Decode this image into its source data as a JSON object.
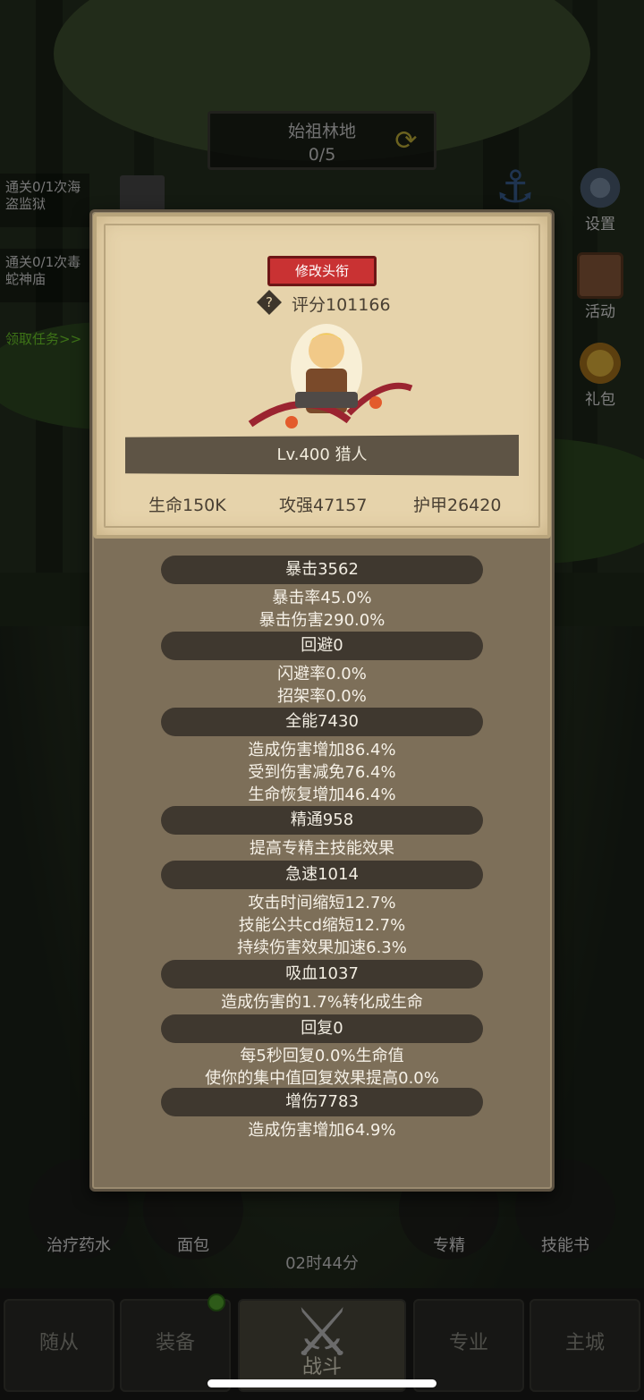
{
  "stage": {
    "name": "始祖林地",
    "progress": "0/5"
  },
  "quests": [
    {
      "text": "通关0/1次海盗监狱"
    },
    {
      "text": "通关0/1次毒蛇神庙"
    }
  ],
  "quest_link": "领取任务>>",
  "side_buttons": {
    "settings": "设置",
    "activity": "活动",
    "gift": "礼包"
  },
  "panel": {
    "rename_button": "修改头衔",
    "score": "评分101166",
    "character": "Lv.400 猎人",
    "card_stats": [
      "生命150K",
      "攻强47157",
      "护甲26420"
    ],
    "stats": [
      {
        "title": "暴击3562",
        "lines": [
          "暴击率45.0%",
          "暴击伤害290.0%"
        ]
      },
      {
        "title": "回避0",
        "lines": [
          "闪避率0.0%",
          "招架率0.0%"
        ]
      },
      {
        "title": "全能7430",
        "lines": [
          "造成伤害增加86.4%",
          "受到伤害减免76.4%",
          "生命恢复增加46.4%"
        ]
      },
      {
        "title": "精通958",
        "lines": [
          "提高专精主技能效果"
        ]
      },
      {
        "title": "急速1014",
        "lines": [
          "攻击时间缩短12.7%",
          "技能公共cd缩短12.7%",
          "持续伤害效果加速6.3%"
        ]
      },
      {
        "title": "吸血1037",
        "lines": [
          "造成伤害的1.7%转化成生命"
        ]
      },
      {
        "title": "回复0",
        "lines": [
          "每5秒回复0.0%生命值",
          "使你的集中值回复效果提高0.0%"
        ]
      },
      {
        "title": "增伤7783",
        "lines": [
          "造成伤害增加64.9%"
        ]
      }
    ]
  },
  "bottom_skills": [
    "治疗药水",
    "面包",
    "专精",
    "技能书"
  ],
  "timer": "02时44分",
  "tabs": [
    "随从",
    "装备",
    "战斗",
    "专业",
    "主城"
  ],
  "colors": {
    "rename_red": "#c93233",
    "quest_green": "#6fcf2b",
    "parchment": "#e6d3ab",
    "panel_brown": "#7d6f59"
  }
}
